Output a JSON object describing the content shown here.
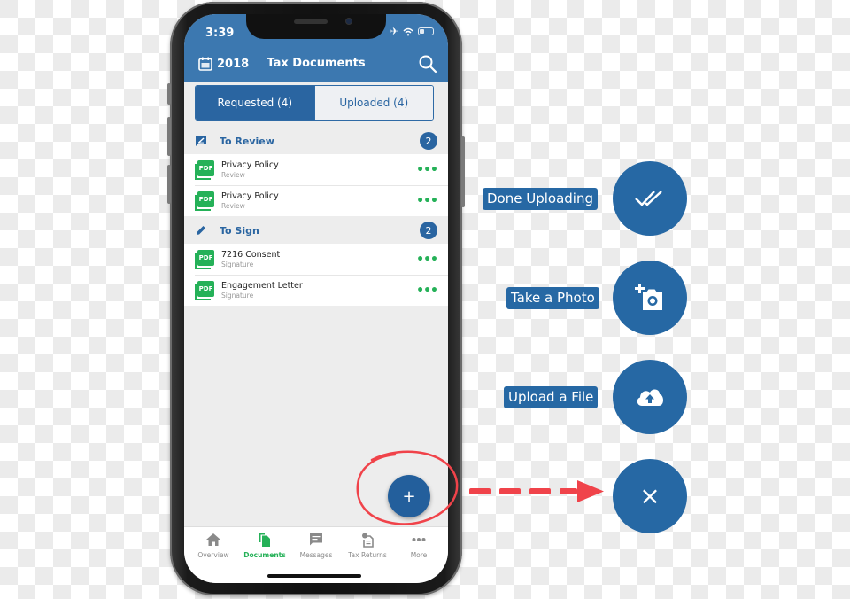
{
  "status_bar": {
    "time": "3:39",
    "icons": [
      "airplane-icon",
      "wifi-icon",
      "battery-icon"
    ]
  },
  "header": {
    "year": "2018",
    "title": "Tax Documents",
    "calendar_icon": "calendar-icon",
    "search_icon": "search-icon"
  },
  "segmented": {
    "requested": "Requested (4)",
    "uploaded": "Uploaded (4)",
    "active": "requested"
  },
  "sections": [
    {
      "title": "To Review",
      "count": "2",
      "icon": "review-icon",
      "items": [
        {
          "name": "Privacy Policy",
          "sub": "Review",
          "badge": "PDF"
        },
        {
          "name": "Privacy Policy",
          "sub": "Review",
          "badge": "PDF"
        }
      ]
    },
    {
      "title": "To Sign",
      "count": "2",
      "icon": "pencil-icon",
      "items": [
        {
          "name": "7216 Consent",
          "sub": "Signature",
          "badge": "PDF"
        },
        {
          "name": "Engagement Letter",
          "sub": "Signature",
          "badge": "PDF"
        }
      ]
    }
  ],
  "fab": {
    "symbol": "+"
  },
  "tabbar": [
    {
      "label": "Overview",
      "icon": "home-icon",
      "active": false
    },
    {
      "label": "Documents",
      "icon": "documents-icon",
      "active": true
    },
    {
      "label": "Messages",
      "icon": "message-icon",
      "active": false
    },
    {
      "label": "Tax Returns",
      "icon": "tax-returns-icon",
      "active": false
    },
    {
      "label": "More",
      "icon": "more-icon",
      "active": false
    }
  ],
  "actions": [
    {
      "label": "Done Uploading",
      "icon": "double-check-icon"
    },
    {
      "label": "Take a Photo",
      "icon": "add-photo-icon"
    },
    {
      "label": "Upload a File",
      "icon": "cloud-upload-icon"
    },
    {
      "label": "",
      "icon": "close-icon",
      "symbol": "×"
    }
  ],
  "colors": {
    "primary": "#2a65a1",
    "header": "#3c78b0",
    "accent_green": "#25b158",
    "annotation_red": "#f0434a"
  }
}
